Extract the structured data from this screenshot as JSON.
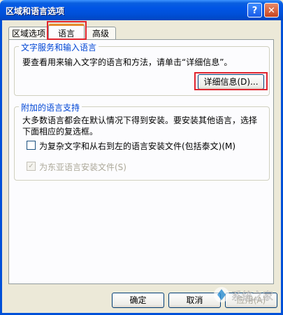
{
  "window": {
    "title": "区域和语言选项"
  },
  "tabs": [
    {
      "label": "区域选项"
    },
    {
      "label": "语言"
    },
    {
      "label": "高级"
    }
  ],
  "text_services": {
    "title": "文字服务和输入语言",
    "description": "要查看用来输入文字的语言和方法，请单击“详细信息”。",
    "details_button": "详细信息(D)..."
  },
  "supplemental": {
    "title": "附加的语言支持",
    "description_line1": "大多数语言都会在默认情况下得到安装。要安装其他语言，选择",
    "description_line2": "下面相应的复选框。",
    "complex_script_label": "为复杂文字和从右到左的语言安装文件(包括泰文)(M)",
    "complex_script_checked": false,
    "east_asian_label": "为东亚语言安装文件(S)",
    "east_asian_checked": true,
    "east_asian_enabled": false
  },
  "footer": {
    "ok": "确定",
    "cancel": "取消",
    "apply": "应用(A)"
  },
  "watermark": {
    "text": "系统之家"
  },
  "colors": {
    "highlight": "#e0242e",
    "group_title": "#0046d5",
    "titlebar": "#0050d8"
  }
}
